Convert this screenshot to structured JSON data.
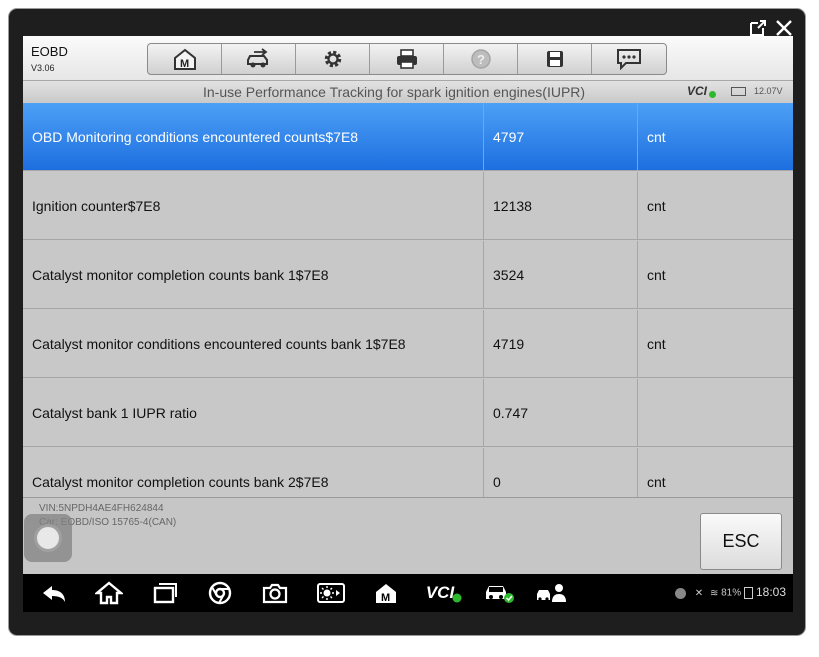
{
  "app": {
    "name": "EOBD",
    "version": "V3.06"
  },
  "toolbar": {
    "buttons": [
      {
        "icon": "home-m-icon"
      },
      {
        "icon": "vehicle-swap-icon"
      },
      {
        "icon": "gear-icon"
      },
      {
        "icon": "printer-icon"
      },
      {
        "icon": "help-icon"
      },
      {
        "icon": "save-icon"
      },
      {
        "icon": "chat-icon"
      }
    ]
  },
  "header": {
    "title": "In-use Performance Tracking for spark ignition engines(IUPR)",
    "vci_label": "VCI",
    "voltage": "12.07V"
  },
  "table": {
    "rows": [
      {
        "name": "OBD Monitoring conditions encountered counts$7E8",
        "value": "4797",
        "unit": "cnt",
        "selected": true
      },
      {
        "name": "Ignition counter$7E8",
        "value": "12138",
        "unit": "cnt",
        "selected": false
      },
      {
        "name": "Catalyst monitor completion counts bank 1$7E8",
        "value": "3524",
        "unit": "cnt",
        "selected": false
      },
      {
        "name": "Catalyst monitor conditions encountered counts bank 1$7E8",
        "value": "4719",
        "unit": "cnt",
        "selected": false
      },
      {
        "name": "Catalyst bank 1 IUPR ratio",
        "value": "0.747",
        "unit": "",
        "selected": false
      },
      {
        "name": "Catalyst monitor completion counts bank 2$7E8",
        "value": "0",
        "unit": "cnt",
        "selected": false
      }
    ]
  },
  "footer": {
    "vin": "VIN:5NPDH4AE4FH624844",
    "car": "Car: EOBD/ISO 15765-4(CAN)",
    "esc_label": "ESC"
  },
  "navbar": {
    "icons": [
      "back-icon",
      "home-icon",
      "recent-apps-icon",
      "chrome-icon",
      "camera-icon",
      "brightness-icon",
      "maxisys-home-icon",
      "vci-icon",
      "car-connect-icon",
      "remote-expert-icon"
    ],
    "vci_text": "VCI",
    "battery": "81%",
    "time": "18:03"
  },
  "colors": {
    "accent": "#1d6fe0",
    "row_bg": "#c8c8c8",
    "frame": "#1e1e1e"
  }
}
